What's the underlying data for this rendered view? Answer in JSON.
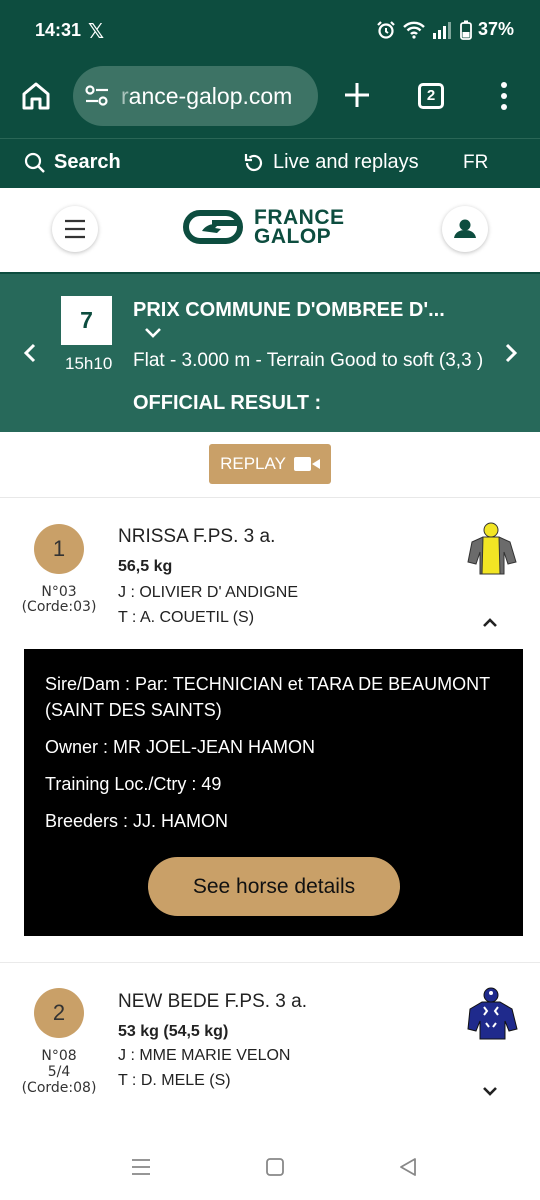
{
  "status": {
    "time": "14:31",
    "x_glyph": "𝕏",
    "battery": "37%"
  },
  "browser": {
    "url_prefix": "r",
    "url_rest": "ance-galop.com",
    "tab_count": "2"
  },
  "nav": {
    "search_label": "Search",
    "live_label": "Live and replays",
    "lang": "FR"
  },
  "logo": {
    "line1": "FRANCE",
    "line2": "GALOP"
  },
  "race": {
    "number": "7",
    "time": "15h10",
    "title": "PRIX COMMUNE D'OMBREE D'...",
    "description": "Flat - 3.000 m - Terrain Good to soft (3,3 )",
    "result_label": "OFFICIAL RESULT :"
  },
  "replay": {
    "label": "REPLAY"
  },
  "runners": [
    {
      "rank": "1",
      "number_line": "N°03",
      "odds_line": "",
      "draw_line": "(Corde:03)",
      "name": "NRISSA F.PS. 3 a.",
      "weight": "56,5 kg",
      "jockey": "J : OLIVIER D' ANDIGNE",
      "trainer": "T : A. COUETIL (S)",
      "silks_colors": {
        "body": "#f2e524",
        "sleeves": "#6b6b6b",
        "cap": "#f2e524"
      }
    },
    {
      "rank": "2",
      "number_line": "N°08",
      "odds_line": "5/4",
      "draw_line": "(Corde:08)",
      "name": "NEW BEDE F.PS. 3 a.",
      "weight": "53 kg (54,5 kg)",
      "jockey": "J : MME MARIE VELON",
      "trainer": "T : D. MELE (S)",
      "silks_colors": {
        "body": "#1f2a8c",
        "sleeves": "#1f2a8c",
        "cap": "#1f2a8c"
      }
    }
  ],
  "details": {
    "sire_dam": "Sire/Dam : Par: TECHNICIAN et TARA DE BEAUMONT (SAINT DES SAINTS)",
    "owner": "Owner : MR JOEL-JEAN HAMON",
    "training": "Training Loc./Ctry : 49",
    "breeders": "Breeders : JJ. HAMON",
    "button": "See horse details"
  },
  "colors": {
    "brand_green": "#0d4d3f",
    "banner_green": "#27695a",
    "gold": "#c9a068"
  }
}
